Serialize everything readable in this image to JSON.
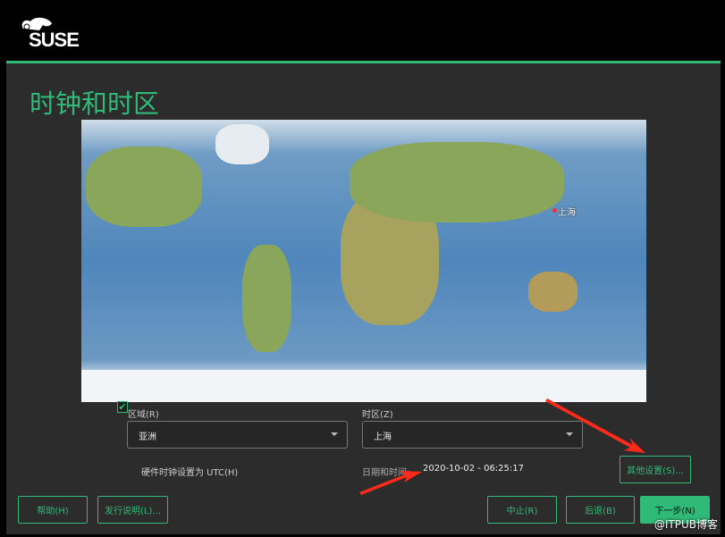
{
  "header": {
    "brand": "SUSE"
  },
  "page": {
    "title": "时钟和时区"
  },
  "map": {
    "selected_city": "上海"
  },
  "region": {
    "label": "区域(R)",
    "value": "亚洲"
  },
  "timezone": {
    "label": "时区(Z)",
    "value": "上海"
  },
  "utc": {
    "label": "硬件时钟设置为 UTC(H)",
    "checked": true
  },
  "datetime": {
    "label": "日期和时间:",
    "value": "2020-10-02 - 06:25:17"
  },
  "buttons": {
    "other": "其他设置(S)...",
    "help": "帮助(H)",
    "release_notes": "发行说明(L)...",
    "abort": "中止(R)",
    "back": "后退(B)",
    "next": "下一步(N)"
  },
  "watermark": "@ITPUB博客",
  "colors": {
    "accent": "#30ba78",
    "annotation": "#ff2a1a"
  }
}
